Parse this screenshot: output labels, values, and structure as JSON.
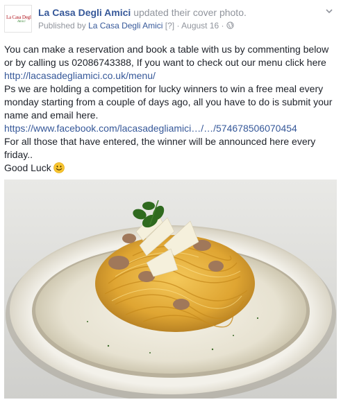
{
  "header": {
    "page_name": "La Casa Degli Amici",
    "action": "updated their cover photo.",
    "published_by_prefix": "Published by",
    "publisher": "La Casa Degli Amici",
    "help_marker": "[?]",
    "separator": "·",
    "date": "August 16",
    "privacy_icon": "globe-icon"
  },
  "avatar": {
    "logo_text": "La Casa Degli",
    "logo_subtext": "Amici"
  },
  "post": {
    "p1_text": "You can make a reservation and book a table with us by commenting below or by calling us 02086743388, If you want to check out our menu click here ",
    "p1_link": "http://lacasadegliamici.co.uk/menu/",
    "p2_text": "Ps we are holding a competition for lucky winners to win a free meal every monday starting from a couple of days ago, all you have to do is submit your name and email here. ",
    "p2_link": "https://www.facebook.com/lacasadegliamici…/…/574678506070454",
    "p3_text": "For all those that have entered, the winner will be announced here every friday..",
    "p4_text": "Good Luck",
    "emoji": "smiley-emoji"
  },
  "photo": {
    "subject": "pasta-dish-photo"
  },
  "colors": {
    "link": "#365899",
    "meta": "#90949c",
    "text": "#1d2129"
  }
}
